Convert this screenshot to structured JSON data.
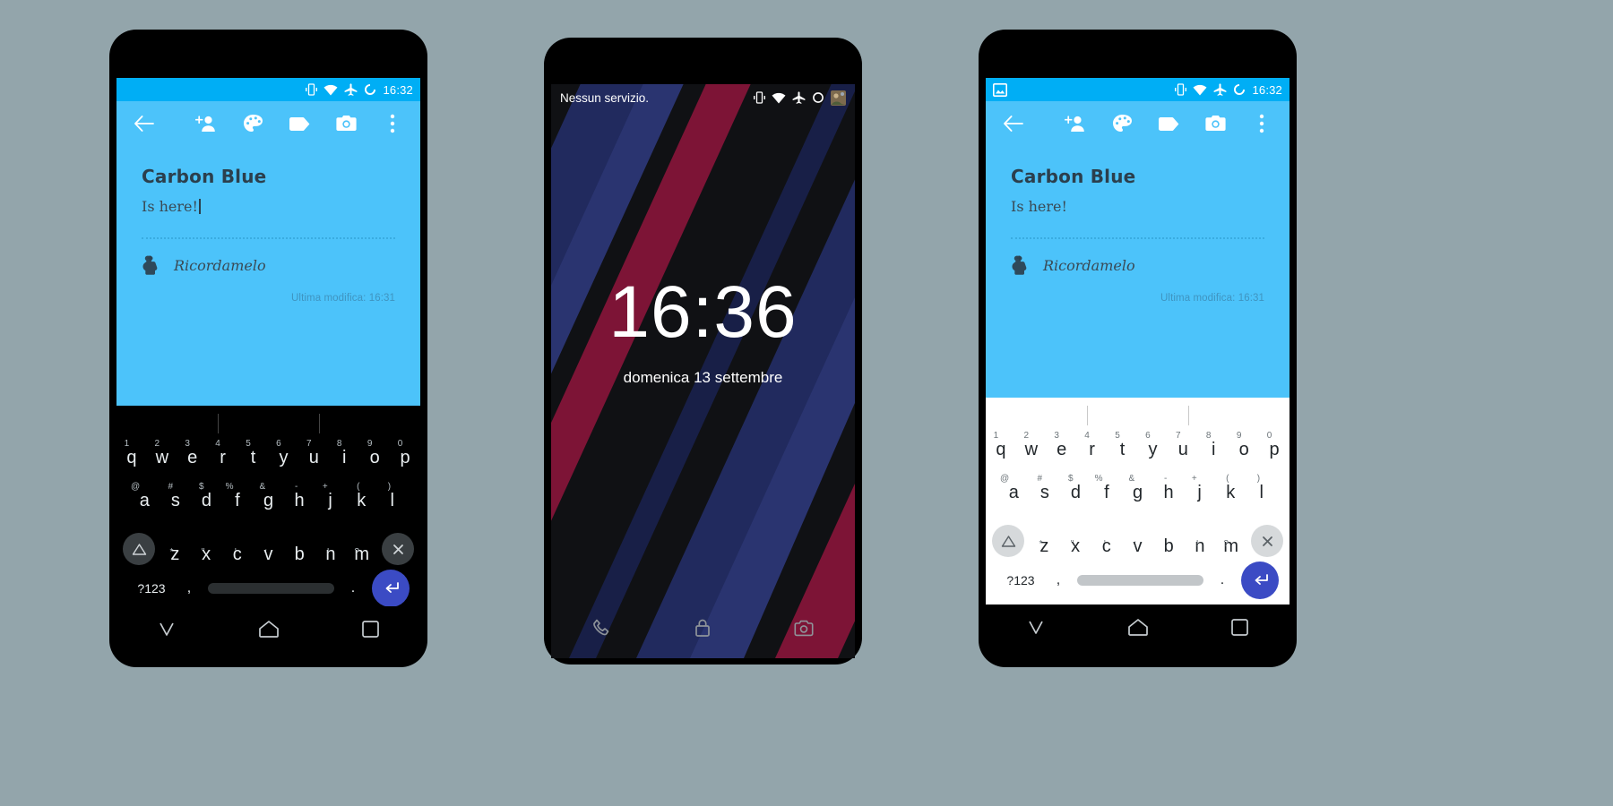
{
  "canvas": {
    "background": "#93a5ab"
  },
  "colors": {
    "status_blue": "#00AEF5",
    "note_blue": "#4CC3FA",
    "note_text": "#2b3f4d",
    "enter_key": "#3b4bc4",
    "wall_navy": "#212a5e",
    "wall_crimson": "#7d1436",
    "wall_black": "#101114"
  },
  "phone1": {
    "statusbar": {
      "time": "16:32",
      "icons": [
        "vibrate-icon",
        "wifi-icon",
        "airplane-icon",
        "sync-icon"
      ]
    },
    "appbar": {
      "back_label": "back-arrow",
      "actions": [
        "add-person-icon",
        "palette-icon",
        "tag-icon",
        "camera-icon",
        "overflow-icon"
      ]
    },
    "note": {
      "title": "Carbon Blue",
      "body": "Is here!",
      "reminder": "Ricordamelo",
      "last_modified": "Ultima modifica: 16:31"
    },
    "keyboard": {
      "theme": "dark",
      "row1": [
        {
          "letter": "q",
          "hint": "1"
        },
        {
          "letter": "w",
          "hint": "2"
        },
        {
          "letter": "e",
          "hint": "3"
        },
        {
          "letter": "r",
          "hint": "4"
        },
        {
          "letter": "t",
          "hint": "5"
        },
        {
          "letter": "y",
          "hint": "6"
        },
        {
          "letter": "u",
          "hint": "7"
        },
        {
          "letter": "i",
          "hint": "8"
        },
        {
          "letter": "o",
          "hint": "9"
        },
        {
          "letter": "p",
          "hint": "0"
        }
      ],
      "row2": [
        {
          "letter": "a",
          "hint": "@"
        },
        {
          "letter": "s",
          "hint": "#"
        },
        {
          "letter": "d",
          "hint": "$"
        },
        {
          "letter": "f",
          "hint": "%"
        },
        {
          "letter": "g",
          "hint": "&"
        },
        {
          "letter": "h",
          "hint": "-"
        },
        {
          "letter": "j",
          "hint": "+"
        },
        {
          "letter": "k",
          "hint": "("
        },
        {
          "letter": "l",
          "hint": ")"
        }
      ],
      "row3": [
        {
          "letter": "z",
          "hint": "*"
        },
        {
          "letter": "x",
          "hint": "\""
        },
        {
          "letter": "c",
          "hint": "'"
        },
        {
          "letter": "v",
          "hint": ":"
        },
        {
          "letter": "b",
          "hint": ";"
        },
        {
          "letter": "n",
          "hint": "!"
        },
        {
          "letter": "m",
          "hint": "?"
        }
      ],
      "shift_label": "shift-key",
      "backspace_label": "backspace-key",
      "sym_label": "?123",
      "comma": ",",
      "period": ".",
      "space_label": "space-bar",
      "enter_label": "enter-key"
    },
    "navbar": [
      "back-nav-icon",
      "home-nav-icon",
      "recents-nav-icon"
    ]
  },
  "phone2": {
    "statusbar": {
      "carrier": "Nessun servizio.",
      "icons": [
        "vibrate-icon",
        "wifi-icon",
        "airplane-icon",
        "sync-icon",
        "avatar-icon"
      ]
    },
    "lockscreen": {
      "clock": "16:36",
      "date": "domenica 13 settembre",
      "shortcuts": [
        "phone-icon",
        "lock-icon",
        "camera-icon"
      ]
    }
  },
  "phone3": {
    "statusbar": {
      "time": "16:32",
      "notification_icon": "screenshot-image-icon",
      "icons": [
        "vibrate-icon",
        "wifi-icon",
        "airplane-icon",
        "sync-icon"
      ]
    },
    "appbar": {
      "back_label": "back-arrow",
      "actions": [
        "add-person-icon",
        "palette-icon",
        "tag-icon",
        "camera-icon",
        "overflow-icon"
      ]
    },
    "note": {
      "title": "Carbon Blue",
      "body": "Is here!",
      "reminder": "Ricordamelo",
      "last_modified": "Ultima modifica: 16:31"
    },
    "keyboard": {
      "theme": "light"
    },
    "navbar": [
      "back-nav-icon",
      "home-nav-icon",
      "recents-nav-icon"
    ]
  }
}
